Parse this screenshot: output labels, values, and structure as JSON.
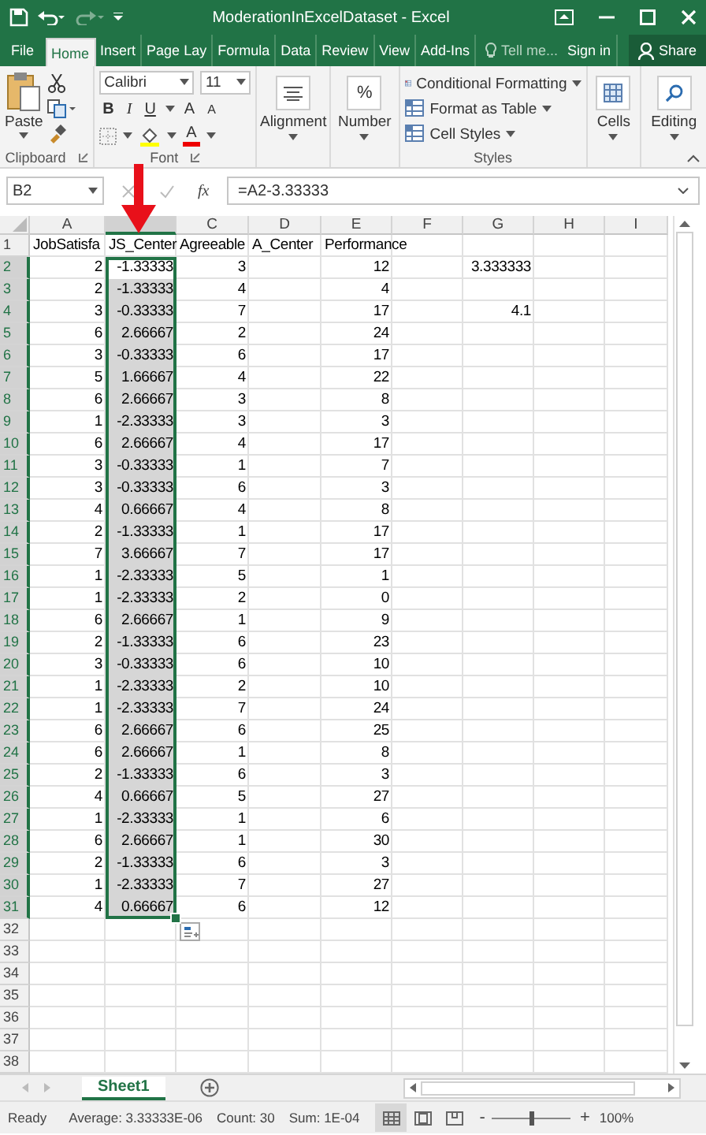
{
  "title_bar": {
    "title": "ModerationInExcelDataset - Excel"
  },
  "tabs": [
    {
      "label": "File",
      "selected": false,
      "kind": "tab"
    },
    {
      "label": "Home",
      "selected": true,
      "kind": "tab"
    },
    {
      "label": "Insert",
      "selected": false,
      "kind": "tab"
    },
    {
      "label": "Page Lay",
      "selected": false,
      "kind": "tab"
    },
    {
      "label": "Formula",
      "selected": false,
      "kind": "tab"
    },
    {
      "label": "Data",
      "selected": false,
      "kind": "tab"
    },
    {
      "label": "Review",
      "selected": false,
      "kind": "tab"
    },
    {
      "label": "View",
      "selected": false,
      "kind": "tab"
    },
    {
      "label": "Add-Ins",
      "selected": false,
      "kind": "tab"
    },
    {
      "label": "Tell me...",
      "selected": false,
      "kind": "search"
    },
    {
      "label": "Sign in",
      "selected": false,
      "kind": "link"
    },
    {
      "label": "Share",
      "selected": false,
      "kind": "share"
    }
  ],
  "ribbon": {
    "paste": "Paste",
    "font_name": "Calibri",
    "font_size": "11",
    "bold": "B",
    "italic": "I",
    "underline": "U",
    "grow": "A",
    "shrink": "A",
    "font_color": "A",
    "alignment": "Alignment",
    "percent": "%",
    "number": "Number",
    "styles": [
      "Conditional Formatting",
      "Format as Table",
      "Cell Styles"
    ],
    "cells": "Cells",
    "editing": "Editing",
    "clipboard_label": "Clipboard",
    "font_label": "Font",
    "styles_label": "Styles"
  },
  "formula_bar": {
    "name_box": "B2",
    "fx": "fx",
    "formula": "=A2-3.33333"
  },
  "columns": [
    {
      "label": "A",
      "selected": false
    },
    {
      "selected": true
    },
    {
      "label": "C",
      "selected": false
    },
    {
      "label": "D",
      "selected": false
    },
    {
      "label": "E",
      "selected": false
    },
    {
      "label": "F",
      "selected": false
    },
    {
      "label": "G",
      "selected": false
    },
    {
      "label": "H",
      "selected": false
    },
    {
      "label": "I",
      "selected": false
    }
  ],
  "rows": [
    {
      "num": "1",
      "selected": false,
      "kind": "text",
      "cells": {
        "A": "JobSatisfa",
        "B": "JS_Center",
        "C": "Agreeable",
        "D": "A_Center",
        "E": "Performance"
      }
    },
    {
      "num": "2",
      "selected": true,
      "kind": "number",
      "cells": {
        "A": "2",
        "B": "-1.33333",
        "C": "3",
        "E": "12",
        "G": "3.333333"
      }
    },
    {
      "num": "3",
      "selected": true,
      "kind": "number",
      "cells": {
        "A": "2",
        "B": "-1.33333",
        "C": "4",
        "E": "4"
      }
    },
    {
      "num": "4",
      "selected": true,
      "kind": "number",
      "cells": {
        "A": "3",
        "B": "-0.33333",
        "C": "7",
        "E": "17",
        "G": "4.1"
      }
    },
    {
      "num": "5",
      "selected": true,
      "kind": "number",
      "cells": {
        "A": "6",
        "B": "2.66667",
        "C": "2",
        "E": "24"
      }
    },
    {
      "num": "6",
      "selected": true,
      "kind": "number",
      "cells": {
        "A": "3",
        "B": "-0.33333",
        "C": "6",
        "E": "17"
      }
    },
    {
      "num": "7",
      "selected": true,
      "kind": "number",
      "cells": {
        "A": "5",
        "B": "1.66667",
        "C": "4",
        "E": "22"
      }
    },
    {
      "num": "8",
      "selected": true,
      "kind": "number",
      "cells": {
        "A": "6",
        "B": "2.66667",
        "C": "3",
        "E": "8"
      }
    },
    {
      "num": "9",
      "selected": true,
      "kind": "number",
      "cells": {
        "A": "1",
        "B": "-2.33333",
        "C": "3",
        "E": "3"
      }
    },
    {
      "num": "10",
      "selected": true,
      "kind": "number",
      "cells": {
        "A": "6",
        "B": "2.66667",
        "C": "4",
        "E": "17"
      }
    },
    {
      "num": "11",
      "selected": true,
      "kind": "number",
      "cells": {
        "A": "3",
        "B": "-0.33333",
        "C": "1",
        "E": "7"
      }
    },
    {
      "num": "12",
      "selected": true,
      "kind": "number",
      "cells": {
        "A": "3",
        "B": "-0.33333",
        "C": "6",
        "E": "3"
      }
    },
    {
      "num": "13",
      "selected": true,
      "kind": "number",
      "cells": {
        "A": "4",
        "B": "0.66667",
        "C": "4",
        "E": "8"
      }
    },
    {
      "num": "14",
      "selected": true,
      "kind": "number",
      "cells": {
        "A": "2",
        "B": "-1.33333",
        "C": "1",
        "E": "17"
      }
    },
    {
      "num": "15",
      "selected": true,
      "kind": "number",
      "cells": {
        "A": "7",
        "B": "3.66667",
        "C": "7",
        "E": "17"
      }
    },
    {
      "num": "16",
      "selected": true,
      "kind": "number",
      "cells": {
        "A": "1",
        "B": "-2.33333",
        "C": "5",
        "E": "1"
      }
    },
    {
      "num": "17",
      "selected": true,
      "kind": "number",
      "cells": {
        "A": "1",
        "B": "-2.33333",
        "C": "2",
        "E": "0"
      }
    },
    {
      "num": "18",
      "selected": true,
      "kind": "number",
      "cells": {
        "A": "6",
        "B": "2.66667",
        "C": "1",
        "E": "9"
      }
    },
    {
      "num": "19",
      "selected": true,
      "kind": "number",
      "cells": {
        "A": "2",
        "B": "-1.33333",
        "C": "6",
        "E": "23"
      }
    },
    {
      "num": "20",
      "selected": true,
      "kind": "number",
      "cells": {
        "A": "3",
        "B": "-0.33333",
        "C": "6",
        "E": "10"
      }
    },
    {
      "num": "21",
      "selected": true,
      "kind": "number",
      "cells": {
        "A": "1",
        "B": "-2.33333",
        "C": "2",
        "E": "10"
      }
    },
    {
      "num": "22",
      "selected": true,
      "kind": "number",
      "cells": {
        "A": "1",
        "B": "-2.33333",
        "C": "7",
        "E": "24"
      }
    },
    {
      "num": "23",
      "selected": true,
      "kind": "number",
      "cells": {
        "A": "6",
        "B": "2.66667",
        "C": "6",
        "E": "25"
      }
    },
    {
      "num": "24",
      "selected": true,
      "kind": "number",
      "cells": {
        "A": "6",
        "B": "2.66667",
        "C": "1",
        "E": "8"
      }
    },
    {
      "num": "25",
      "selected": true,
      "kind": "number",
      "cells": {
        "A": "2",
        "B": "-1.33333",
        "C": "6",
        "E": "3"
      }
    },
    {
      "num": "26",
      "selected": true,
      "kind": "number",
      "cells": {
        "A": "4",
        "B": "0.66667",
        "C": "5",
        "E": "27"
      }
    },
    {
      "num": "27",
      "selected": true,
      "kind": "number",
      "cells": {
        "A": "1",
        "B": "-2.33333",
        "C": "1",
        "E": "6"
      }
    },
    {
      "num": "28",
      "selected": true,
      "kind": "number",
      "cells": {
        "A": "6",
        "B": "2.66667",
        "C": "1",
        "E": "30"
      }
    },
    {
      "num": "29",
      "selected": true,
      "kind": "number",
      "cells": {
        "A": "2",
        "B": "-1.33333",
        "C": "6",
        "E": "3"
      }
    },
    {
      "num": "30",
      "selected": true,
      "kind": "number",
      "cells": {
        "A": "1",
        "B": "-2.33333",
        "C": "7",
        "E": "27"
      }
    },
    {
      "num": "31",
      "selected": true,
      "kind": "number",
      "cells": {
        "A": "4",
        "B": "0.66667",
        "C": "6",
        "E": "12"
      }
    },
    {
      "num": "32",
      "selected": false
    },
    {
      "num": "33",
      "selected": false
    },
    {
      "num": "34",
      "selected": false
    },
    {
      "num": "35",
      "selected": false
    },
    {
      "num": "36",
      "selected": false
    },
    {
      "num": "37",
      "selected": false
    },
    {
      "num": "38",
      "selected": false
    }
  ],
  "sheet_tabs": [
    {
      "label": "Sheet1",
      "selected": true
    }
  ],
  "status_bar": {
    "ready": "Ready",
    "average": "Average: 3.33333E-06",
    "count": "Count: 30",
    "sum": "Sum: 1E-04",
    "zoom": {
      "minus": "-",
      "plus": "+",
      "level": 0.5,
      "reading": "100%"
    }
  }
}
